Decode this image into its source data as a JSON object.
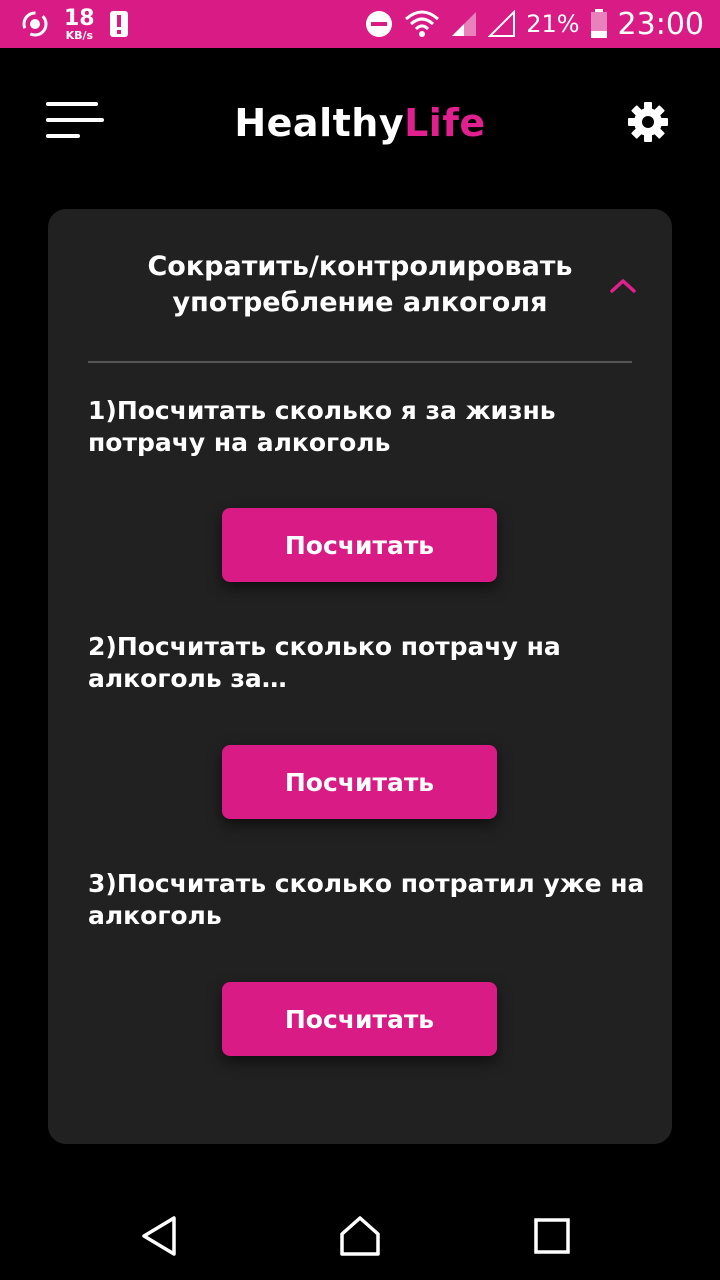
{
  "status_bar": {
    "speed_value": "18",
    "speed_unit": "KB/s",
    "battery_percent": "21%",
    "time": "23:00",
    "icons": [
      "sync-icon",
      "alert-icon",
      "dnd-icon",
      "wifi-icon",
      "signal-icon",
      "signal-empty-icon",
      "battery-icon"
    ]
  },
  "header": {
    "title_main": "Healthy",
    "title_accent": "Life",
    "accent_color": "#e0208f",
    "menu_icon": "menu-icon",
    "settings_icon": "gear-icon"
  },
  "card": {
    "title": "Сократить/контролировать употребление алкоголя",
    "collapse_icon": "chevron-up-icon",
    "tasks": [
      {
        "text": "1)Посчитать сколько я за жизнь потрачу на алкоголь",
        "button_label": "Посчитать"
      },
      {
        "text": "2)Посчитать сколько потрачу на алкоголь за…",
        "button_label": "Посчитать"
      },
      {
        "text": "3)Посчитать сколько потратил уже на алкоголь",
        "button_label": "Посчитать"
      }
    ]
  },
  "nav_bar": {
    "icons": [
      "back-icon",
      "home-icon",
      "recent-apps-icon"
    ]
  },
  "colors": {
    "brand": "#d81b85",
    "background": "#000000",
    "card": "#212121"
  }
}
